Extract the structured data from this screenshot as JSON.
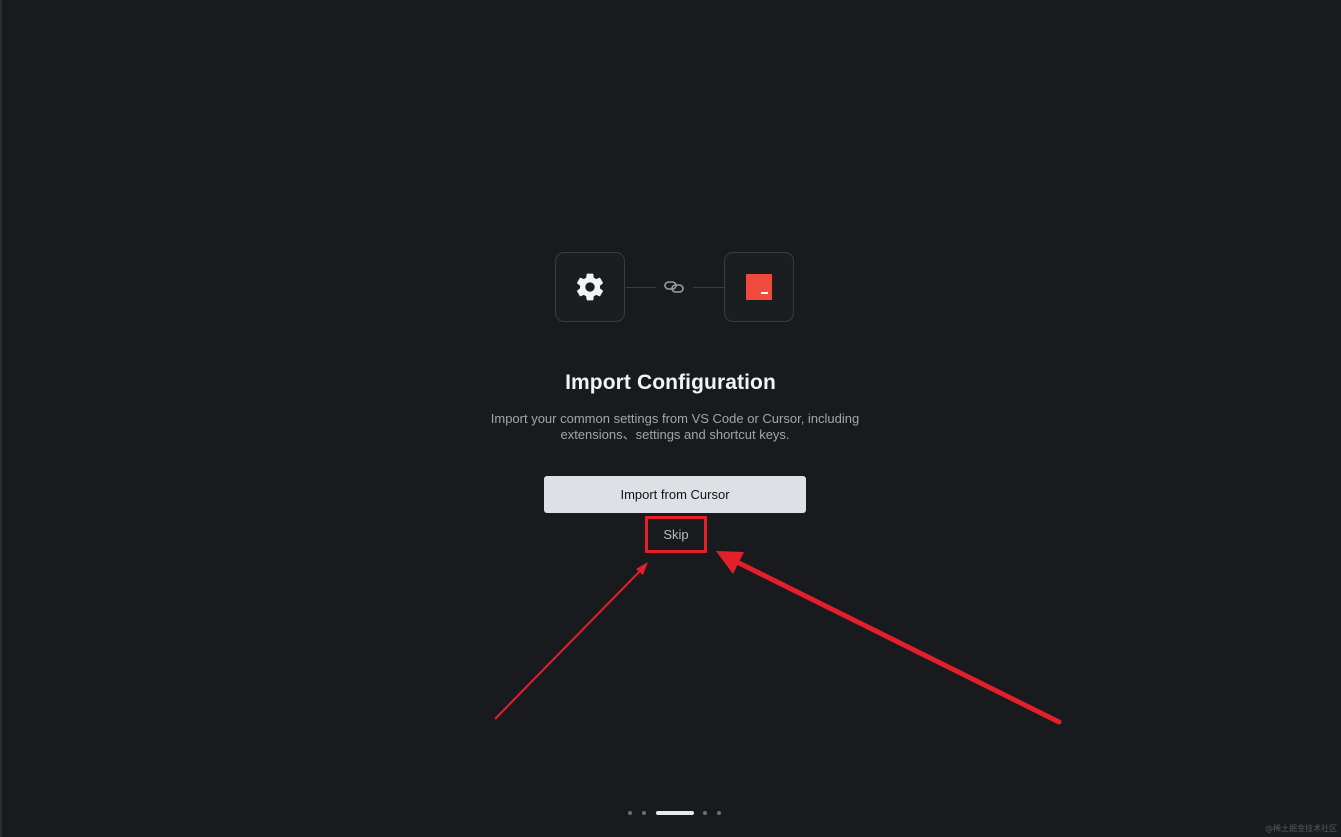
{
  "onboarding": {
    "title": "Import Configuration",
    "description": "Import your common settings from VS Code or Cursor, including extensions、settings and shortcut keys.",
    "primary_button_label": "Import from Cursor",
    "skip_label": "Skip",
    "icons": {
      "source": "gear-icon",
      "connector": "link-icon",
      "target": "trae-logo-icon"
    },
    "pager": {
      "total_steps": 5,
      "current_step": 3
    }
  },
  "annotation": {
    "highlight_color": "#e3202a",
    "arrows_count": 2
  },
  "watermark": "@稀土掘金技术社区",
  "colors": {
    "background": "#181a1e",
    "brand": "#ef4a3c",
    "primary_button_bg": "#dfe0e5"
  }
}
